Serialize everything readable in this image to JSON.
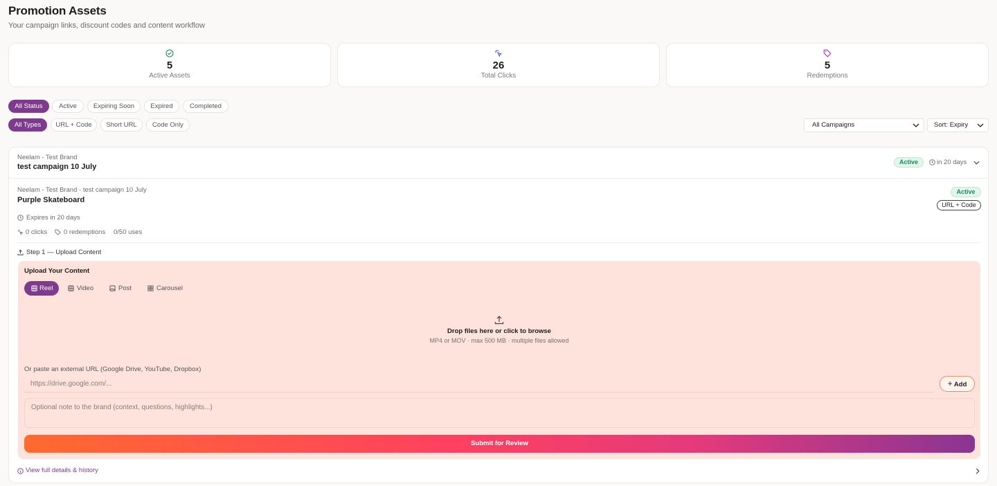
{
  "header": {
    "title": "Promotion Assets",
    "subtitle": "Your campaign links, discount codes and content workflow"
  },
  "stats": [
    {
      "icon": "check-circle-icon",
      "value": "5",
      "label": "Active Assets",
      "color": "#1f8a57"
    },
    {
      "icon": "click-icon",
      "value": "26",
      "label": "Total Clicks",
      "color": "#3b5bd9"
    },
    {
      "icon": "tag-icon",
      "value": "5",
      "label": "Redemptions",
      "color": "#9b3fb5"
    }
  ],
  "status_filters": [
    "All Status",
    "Active",
    "Expiring Soon",
    "Expired",
    "Completed"
  ],
  "type_filters": [
    "All Types",
    "URL + Code",
    "Short URL",
    "Code Only"
  ],
  "selects": {
    "campaign": "All Campaigns",
    "sort": "Sort: Expiry"
  },
  "campaign_group": {
    "brand": "Neelam - Test Brand",
    "name": "test campaign 10 July",
    "status": "Active",
    "expiry": "in 20 days"
  },
  "asset": {
    "breadcrumb": "Neelam - Test Brand · test campaign 10 July",
    "name": "Purple Skateboard",
    "status": "Active",
    "type": "URL + Code",
    "expires": "Expires in 20 days",
    "clicks": "0 clicks",
    "redemptions": "0 redemptions",
    "uses": "0/50 uses",
    "step": "Step 1 — Upload Content"
  },
  "upload": {
    "title": "Upload Your Content",
    "tabs": [
      "Reel",
      "Video",
      "Post",
      "Carousel"
    ],
    "drop_title": "Drop files here or click to browse",
    "drop_hint": "MP4 or MOV · max 500 MB · multiple files allowed",
    "url_label": "Or paste an external URL (Google Drive, YouTube, Dropbox)",
    "url_placeholder": "https://drive.google.com/...",
    "add_label": "Add",
    "note_placeholder": "Optional note to the brand (context, questions, highlights...)",
    "submit_label": "Submit for Review"
  },
  "footer_link": "View full details & history",
  "colors": {
    "accent": "#7e3a8c",
    "upload_bg": "#fde3dc",
    "active_green": "#1f8a57"
  }
}
